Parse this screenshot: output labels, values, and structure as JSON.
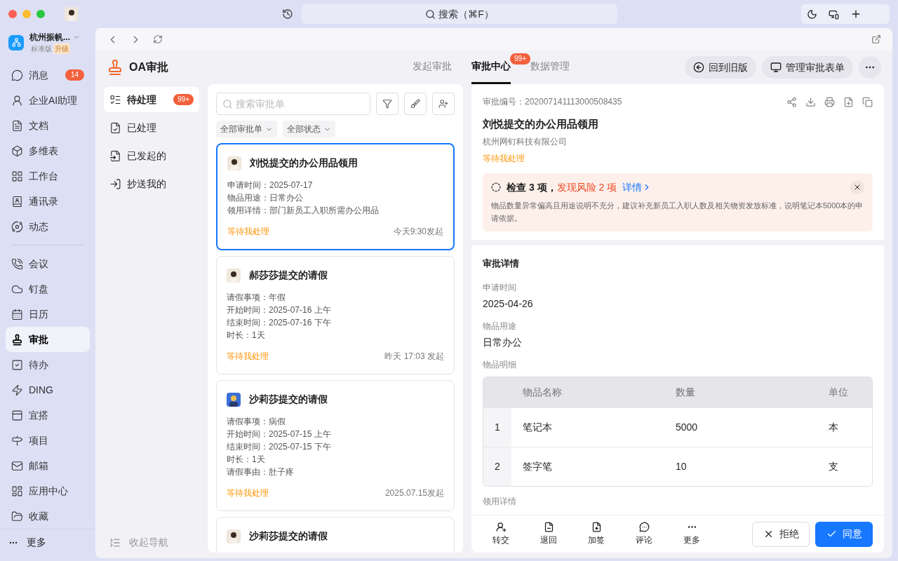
{
  "titlebar": {
    "search": "搜索（⌘F）"
  },
  "sidebar": {
    "org_name": "杭州振帆...",
    "edition": "标准版",
    "upgrade": "升级",
    "primary": [
      {
        "label": "消息",
        "badge": "14",
        "selected": false
      },
      {
        "label": "企业AI助理",
        "selected": false
      },
      {
        "label": "文档",
        "selected": false
      },
      {
        "label": "多维表",
        "selected": false
      },
      {
        "label": "工作台",
        "selected": false
      },
      {
        "label": "通讯录",
        "selected": false
      },
      {
        "label": "动态",
        "selected": false
      }
    ],
    "secondary": [
      {
        "label": "会议",
        "selected": false
      },
      {
        "label": "钉盘",
        "selected": false
      },
      {
        "label": "日历",
        "selected": false
      },
      {
        "label": "审批",
        "selected": true
      },
      {
        "label": "待办",
        "selected": false
      },
      {
        "label": "DING",
        "selected": false
      },
      {
        "label": "宜搭",
        "selected": false
      },
      {
        "label": "项目",
        "selected": false
      },
      {
        "label": "邮箱",
        "selected": false
      },
      {
        "label": "应用中心",
        "selected": false
      },
      {
        "label": "收藏",
        "selected": false
      }
    ],
    "more": "更多"
  },
  "app": {
    "title": "OA审批",
    "tabs": [
      {
        "label": "发起审批",
        "selected": false
      },
      {
        "label": "审批中心",
        "selected": true,
        "badge": "99+"
      },
      {
        "label": "数据管理",
        "selected": false
      }
    ],
    "actions": [
      "回到旧版",
      "管理审批表单"
    ]
  },
  "nav": {
    "items": [
      {
        "label": "待处理",
        "selected": true,
        "badge": "99+"
      },
      {
        "label": "已处理",
        "selected": false
      },
      {
        "label": "已发起的",
        "selected": false
      },
      {
        "label": "抄送我的",
        "selected": false
      }
    ],
    "collapse": "收起导航"
  },
  "list": {
    "search_placeholder": "搜索审批单",
    "filters": [
      "全部审批单",
      "全部状态"
    ],
    "cards": [
      {
        "title": "刘悦提交的办公用品领用",
        "selected": true,
        "fields": [
          {
            "label": "申请时间：",
            "value": "2025-07-17"
          },
          {
            "label": "物品用途：",
            "value": "日常办公"
          },
          {
            "label": "领用详情：",
            "value": "部门新员工入职所需办公用品"
          }
        ],
        "status": "等待我处理",
        "time": "今天9:30发起"
      },
      {
        "title": "郝莎莎提交的请假",
        "selected": false,
        "fields": [
          {
            "label": "请假事项：",
            "value": "年假"
          },
          {
            "label": "开始时间：",
            "value": "2025-07-16 上午"
          },
          {
            "label": "结束时间：",
            "value": "2025-07-16 下午"
          },
          {
            "label": "时长：",
            "value": "1天"
          }
        ],
        "status": "等待我处理",
        "time": "昨天 17:03 发起"
      },
      {
        "title": "沙莉莎提交的请假",
        "selected": false,
        "fields": [
          {
            "label": "请假事项：",
            "value": "病假"
          },
          {
            "label": "开始时间：",
            "value": "2025-07-15 上午"
          },
          {
            "label": "结束时间：",
            "value": "2025-07-15 下午"
          },
          {
            "label": "时长：",
            "value": "1天"
          },
          {
            "label": "请假事由：",
            "value": "肚子疼"
          }
        ],
        "status": "等待我处理",
        "time": "2025.07.15发起"
      },
      {
        "title": "沙莉莎提交的请假",
        "selected": false
      }
    ]
  },
  "detail": {
    "number_label": "审批编号：",
    "number": "202007141113000508435",
    "title": "刘悦提交的办公用品领用",
    "company": "杭州网钉科技有限公司",
    "status": "等待我处理",
    "risk": {
      "summary": "检查 3 项，",
      "risk": "发现风险 2 项",
      "link": "详情",
      "message": "物品数量异常偏高且用途说明不充分，建议补充新员工入职人数及相关物资发放标准，说明笔记本5000本的申请依据。"
    },
    "section_title": "审批详情",
    "fields": [
      {
        "label": "申请时间",
        "value": "2025-04-26"
      },
      {
        "label": "物品用途",
        "value": "日常办公"
      }
    ],
    "table": {
      "label": "物品明细",
      "columns": [
        "",
        "物品名称",
        "数量",
        "单位"
      ],
      "rows": [
        [
          "1",
          "笔记本",
          "5000",
          "本"
        ],
        [
          "2",
          "签字笔",
          "10",
          "支"
        ]
      ]
    },
    "tail_field": {
      "label": "领用详情"
    },
    "footer_actions": [
      "转交",
      "退回",
      "加签",
      "评论",
      "更多"
    ],
    "reject": "拒绝",
    "approve": "同意"
  }
}
